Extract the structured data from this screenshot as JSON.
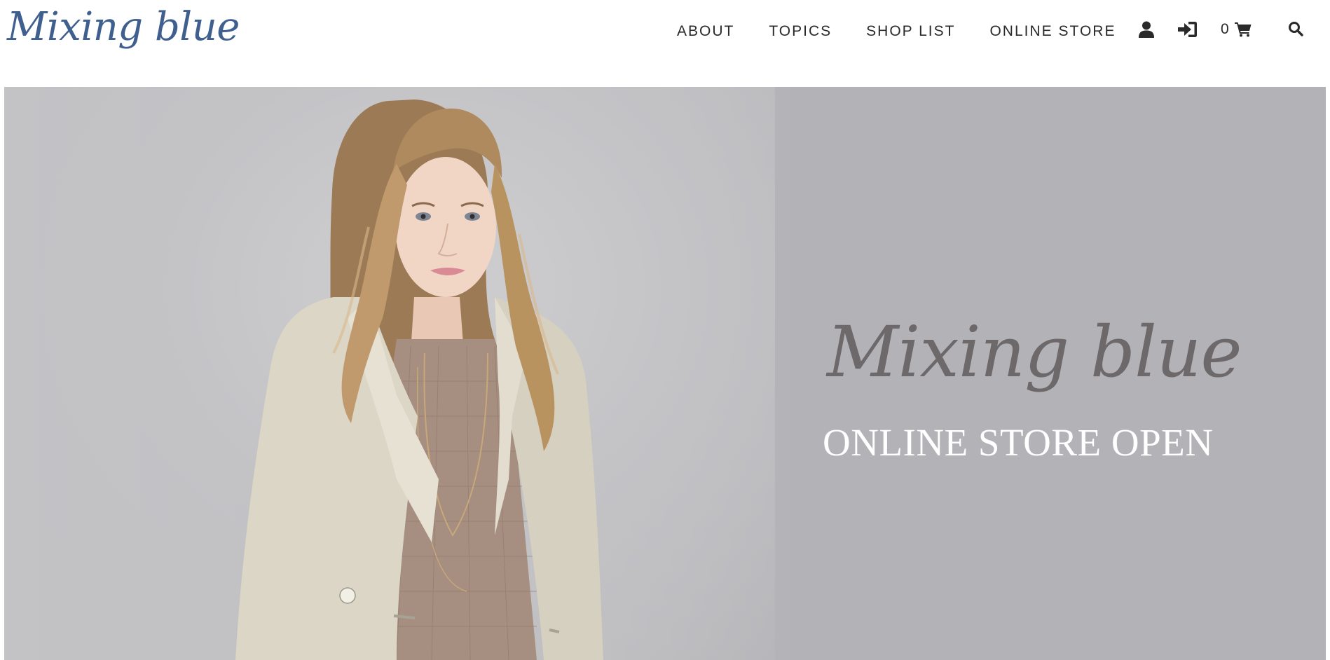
{
  "header": {
    "logo": "Mixing blue",
    "nav": [
      {
        "label": "ABOUT"
      },
      {
        "label": "TOPICS"
      },
      {
        "label": "SHOP LIST"
      },
      {
        "label": "ONLINE STORE"
      }
    ],
    "icons": {
      "account": "user-icon",
      "login": "sign-in-icon",
      "cart": "shopping-cart-icon",
      "search": "search-icon"
    },
    "cart_count": "0"
  },
  "hero": {
    "brand": "Mixing blue",
    "tagline": "ONLINE STORE OPEN"
  },
  "colors": {
    "logo": "#3f5f8f",
    "hero_background": "#b3b3b7",
    "hero_brand": "#6d686a",
    "hero_tagline": "#ffffff"
  }
}
